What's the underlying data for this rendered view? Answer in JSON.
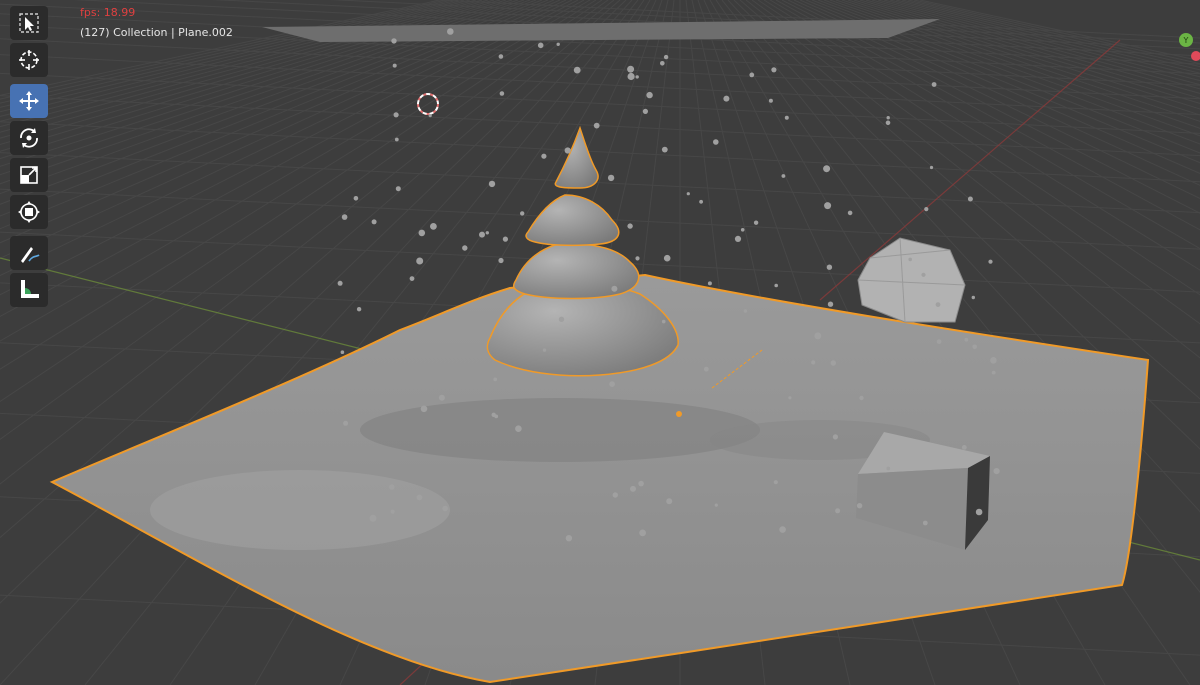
{
  "viewport": {
    "fps_text": "fps: 18.99",
    "context_text": "(127) Collection | Plane.002",
    "background_color": "#3d3d3d",
    "selection_outline_color": "#f09a28"
  },
  "toolbar": {
    "tools": [
      {
        "name": "select-box-tool",
        "icon": "select-arrow-icon",
        "active": false
      },
      {
        "name": "cursor-tool",
        "icon": "cursor-target-icon",
        "active": false
      },
      {
        "name": "move-tool",
        "icon": "move-arrows-icon",
        "active": true
      },
      {
        "name": "rotate-tool",
        "icon": "rotate-icon",
        "active": false
      },
      {
        "name": "scale-tool",
        "icon": "scale-icon",
        "active": false
      },
      {
        "name": "transform-tool",
        "icon": "transform-icon",
        "active": false
      },
      {
        "name": "annotate-tool",
        "icon": "annotate-pen-icon",
        "active": false
      },
      {
        "name": "measure-tool",
        "icon": "measure-ruler-icon",
        "active": false
      }
    ]
  },
  "gizmo": {
    "y_label": "Y"
  }
}
